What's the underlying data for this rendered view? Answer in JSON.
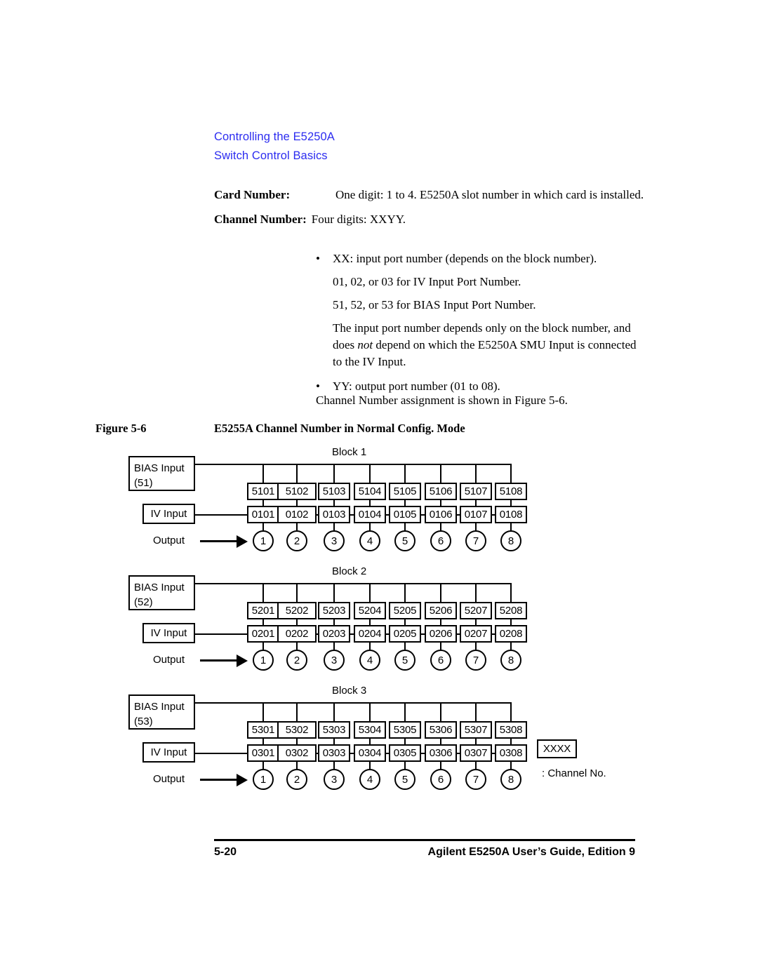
{
  "header": {
    "line1": "Controlling the E5250A",
    "line2": "Switch Control Basics",
    "color": "#2c2cf0"
  },
  "definitions": [
    {
      "term": "Card Number:",
      "body": "One digit: 1 to 4. E5250A slot number in which card is installed."
    },
    {
      "term": "Channel Number:",
      "body": "Four digits: XXYY."
    }
  ],
  "bullets": {
    "item1": "XX: input port number (depends on the block number).",
    "sub1": "01, 02, or 03 for IV Input Port Number.",
    "sub2": "51, 52, or 53 for BIAS Input Port Number.",
    "sub3_pre": "The input port number depends only on the block number, and does ",
    "sub3_em": "not",
    "sub3_post": " depend on which the E5250A SMU Input is connected to the IV Input.",
    "item2": "YY: output port number (01 to 08).",
    "bullet_glyph": "•",
    "closing": "Channel Number assignment is shown in Figure 5-6."
  },
  "figure_caption": {
    "number": "Figure 5-6",
    "title": "E5255A Channel Number in Normal Config. Mode"
  },
  "figure": {
    "labels": {
      "iv_input": "IV Input",
      "output": "Output",
      "bias_input": "BIAS Input"
    },
    "legend": {
      "box": "XXXX",
      "text": ": Channel No."
    },
    "blocks": [
      {
        "title": "Block 1",
        "bias_port": "(51)",
        "bias_row": [
          "5101",
          "5102",
          "5103",
          "5104",
          "5105",
          "5106",
          "5107",
          "5108"
        ],
        "iv_row": [
          "0101",
          "0102",
          "0103",
          "0104",
          "0105",
          "0106",
          "0107",
          "0108"
        ],
        "outputs": [
          "1",
          "2",
          "3",
          "4",
          "5",
          "6",
          "7",
          "8"
        ]
      },
      {
        "title": "Block 2",
        "bias_port": "(52)",
        "bias_row": [
          "5201",
          "5202",
          "5203",
          "5204",
          "5205",
          "5206",
          "5207",
          "5208"
        ],
        "iv_row": [
          "0201",
          "0202",
          "0203",
          "0204",
          "0205",
          "0206",
          "0207",
          "0208"
        ],
        "outputs": [
          "1",
          "2",
          "3",
          "4",
          "5",
          "6",
          "7",
          "8"
        ]
      },
      {
        "title": "Block 3",
        "bias_port": "(53)",
        "bias_row": [
          "5301",
          "5302",
          "5303",
          "5304",
          "5305",
          "5306",
          "5307",
          "5308"
        ],
        "iv_row": [
          "0301",
          "0302",
          "0303",
          "0304",
          "0305",
          "0306",
          "0307",
          "0308"
        ],
        "outputs": [
          "1",
          "2",
          "3",
          "4",
          "5",
          "6",
          "7",
          "8"
        ]
      }
    ]
  },
  "footer": {
    "page_number": "5-20",
    "guide_title": "Agilent E5250A User’s Guide, Edition  9"
  }
}
